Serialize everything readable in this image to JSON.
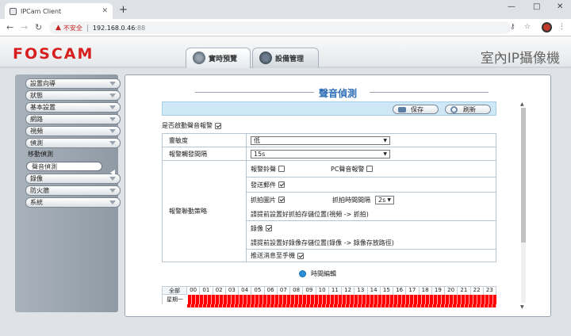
{
  "browser": {
    "tab_title": "IPCam Client",
    "new_tab": "+",
    "minimize": "—",
    "maximize": "□",
    "close": "✕",
    "insecure_label": "不安全",
    "url_host": "192.168.0.46",
    "url_port": ":88"
  },
  "header": {
    "logo": "FOSCAM",
    "product_name": "室內IP攝像機",
    "tab_live": "實時預覽",
    "tab_settings": "設備管理"
  },
  "sidebar": {
    "items_top": [
      {
        "label": "設置向導"
      },
      {
        "label": "狀態"
      },
      {
        "label": "基本設置"
      },
      {
        "label": "網路"
      },
      {
        "label": "視頻"
      },
      {
        "label": "偵測"
      }
    ],
    "sub_items": [
      {
        "label": "移動偵測"
      },
      {
        "label": "聲音偵測"
      }
    ],
    "items_bottom": [
      {
        "label": "錄像"
      },
      {
        "label": "防火牆"
      },
      {
        "label": "系統"
      }
    ]
  },
  "panel": {
    "title": "聲音偵測",
    "save_label": "保存",
    "refresh_label": "刷新",
    "enable_label": "是否啟動聲音報警",
    "sensitivity_label": "靈敏度",
    "sensitivity_value": "低",
    "interval_label": "報警觸發間隔",
    "interval_value": "15s",
    "action_label": "報警聯動策略",
    "ring_label": "報警鈴聲",
    "pc_alarm_label": "PC聲音報警",
    "email_label": "發送郵件",
    "snapshot_label": "抓拍圖片",
    "snap_interval_label": "抓拍時間間隔",
    "snap_interval_value": "2s",
    "snap_note": "請提前設置好抓拍存儲位置(視頻 -> 抓拍)",
    "record_label": "錄像",
    "record_note": "請提前設置好錄像存儲位置(錄像 -> 錄像存放路徑)",
    "push_label": "推送消息至手機",
    "schedule_link": "時間編輯",
    "schedule_all": "全部",
    "schedule_hours": [
      "00",
      "01",
      "02",
      "03",
      "04",
      "05",
      "06",
      "07",
      "08",
      "09",
      "10",
      "11",
      "12",
      "13",
      "14",
      "15",
      "16",
      "17",
      "18",
      "19",
      "20",
      "21",
      "22",
      "23"
    ],
    "schedule_day1": "星期一"
  },
  "checkboxes": {
    "enable": true,
    "ring": false,
    "pc_alarm": false,
    "email": true,
    "snapshot": true,
    "record": true,
    "push": true
  },
  "colors": {
    "logo_red": "#d6201f",
    "title_blue": "#2e6fb7",
    "schedule_red": "#ff0000",
    "toolbar_bg": "#cfe8f7"
  }
}
